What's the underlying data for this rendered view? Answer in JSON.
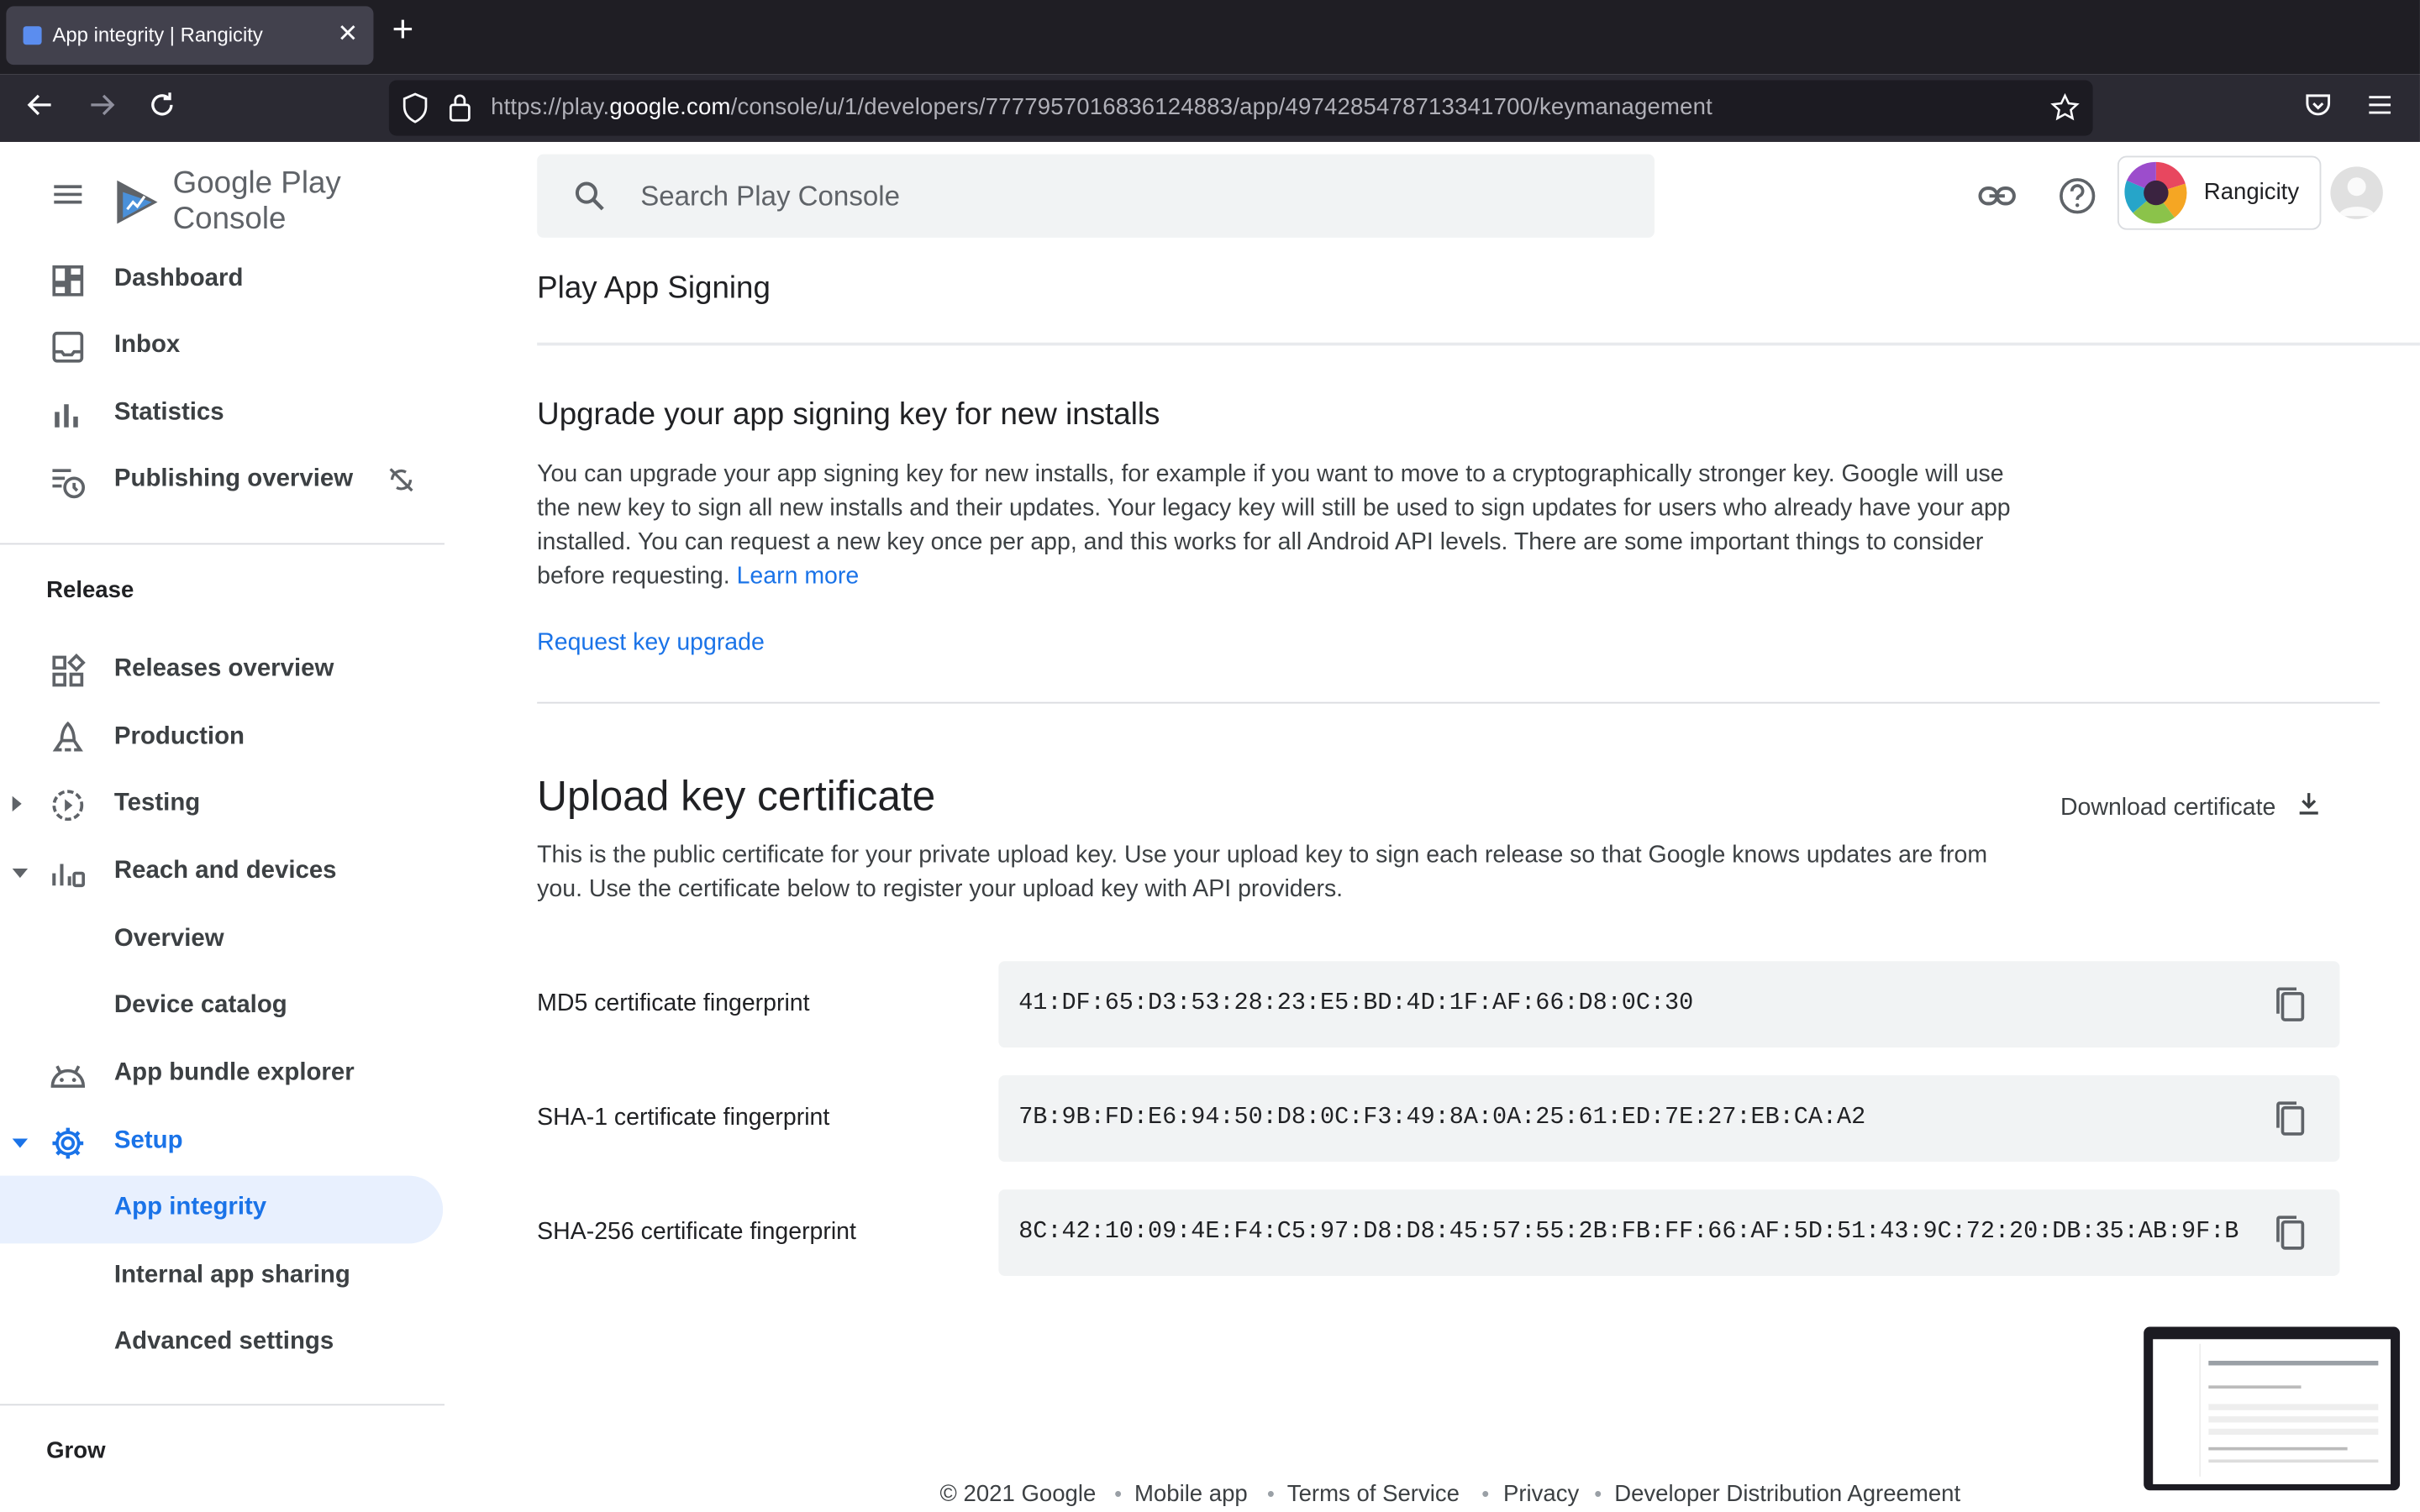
{
  "browser": {
    "tab_title": "App integrity | Rangicity",
    "url_prefix": "https://play.",
    "url_domain": "google.com",
    "url_path": "/console/u/1/developers/7777957016836124883/app/4974285478713341700/keymanagement"
  },
  "header": {
    "product_name_1": "Google Play",
    "product_name_2": "Console",
    "search_placeholder": "Search Play Console",
    "account_name": "Rangicity"
  },
  "sidebar": {
    "top_items": [
      {
        "label": "Dashboard",
        "icon": "dashboard-icon"
      },
      {
        "label": "Inbox",
        "icon": "inbox-icon"
      },
      {
        "label": "Statistics",
        "icon": "bar-chart-icon"
      },
      {
        "label": "Publishing overview",
        "icon": "schedule-icon"
      }
    ],
    "release_heading": "Release",
    "release_items": [
      {
        "label": "Releases overview",
        "icon": "grid-icon"
      },
      {
        "label": "Production",
        "icon": "rocket-icon"
      },
      {
        "label": "Testing",
        "icon": "play-circle-icon"
      },
      {
        "label": "Reach and devices",
        "icon": "devices-chart-icon"
      },
      {
        "label": "Overview"
      },
      {
        "label": "Device catalog"
      },
      {
        "label": "App bundle explorer",
        "icon": "android-icon"
      },
      {
        "label": "Setup",
        "icon": "gear-icon"
      },
      {
        "label": "App integrity"
      },
      {
        "label": "Internal app sharing"
      },
      {
        "label": "Advanced settings"
      }
    ],
    "grow_heading": "Grow"
  },
  "main": {
    "page_title": "Play App Signing",
    "upgrade": {
      "heading": "Upgrade your app signing key for new installs",
      "body": "You can upgrade your app signing key for new installs, for example if you want to move to a cryptographically stronger key. Google will use the new key to sign all new installs and their updates. Your legacy key will still be used to sign updates for users who already have your app installed. You can request a new key once per app, and this works for all Android API levels. There are some important things to consider before requesting.",
      "learn_more": "Learn more",
      "request_link": "Request key upgrade"
    },
    "upload": {
      "heading": "Upload key certificate",
      "download": "Download certificate",
      "body": "This is the public certificate for your private upload key. Use your upload key to sign each release so that Google knows updates are from you. Use the certificate below to register your upload key with API providers.",
      "fingerprints": [
        {
          "label": "MD5 certificate fingerprint",
          "value": "41:DF:65:D3:53:28:23:E5:BD:4D:1F:AF:66:D8:0C:30"
        },
        {
          "label": "SHA-1 certificate fingerprint",
          "value": "7B:9B:FD:E6:94:50:D8:0C:F3:49:8A:0A:25:61:ED:7E:27:EB:CA:A2"
        },
        {
          "label": "SHA-256 certificate fingerprint",
          "value": "8C:42:10:09:4E:F4:C5:97:D8:D8:45:57:55:2B:FB:FF:66:AF:5D:51:43:9C:72:20:DB:35:AB:9F:B"
        }
      ]
    }
  },
  "footer": {
    "copyright": "© 2021 Google",
    "links": [
      "Mobile app",
      "Terms of Service",
      "Privacy",
      "Developer Distribution Agreement"
    ]
  },
  "colors": {
    "accent": "#1a73e8",
    "active_bg": "#e8f0fe"
  }
}
